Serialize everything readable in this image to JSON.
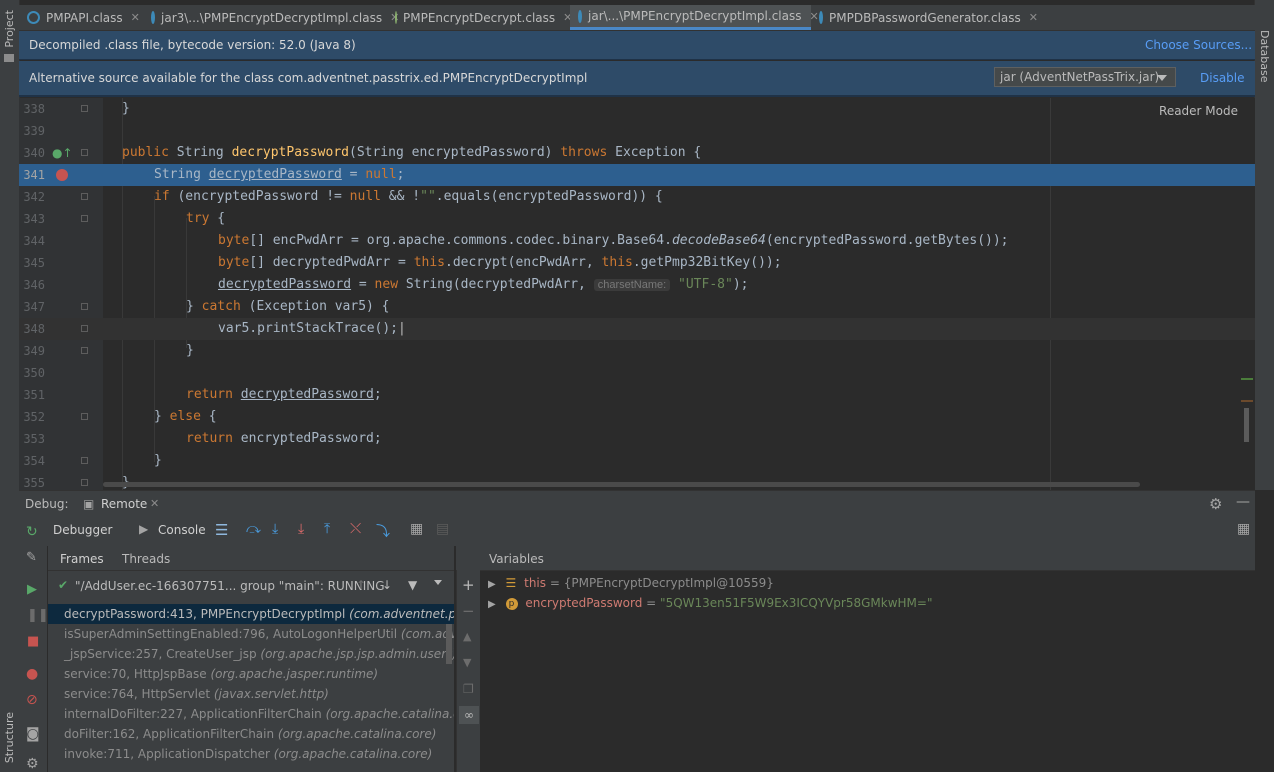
{
  "side_tabs": {
    "project": "Project",
    "structure": "Structure",
    "database": "Database"
  },
  "tabs": [
    {
      "label": "PMPAPI.class",
      "active": false
    },
    {
      "label": "jar3\\...\\PMPEncryptDecryptImpl.class",
      "active": false
    },
    {
      "label": "PMPEncryptDecrypt.class",
      "active": false
    },
    {
      "label": "jar\\...\\PMPEncryptDecryptImpl.class",
      "active": true
    },
    {
      "label": "PMPDBPasswordGenerator.class",
      "active": false
    }
  ],
  "banner1": {
    "text": "Decompiled .class file, bytecode version: 52.0 (Java 8)",
    "link": "Choose Sources..."
  },
  "banner2": {
    "text": "Alternative source available for the class com.adventnet.passtrix.ed.PMPEncryptDecryptImpl",
    "combo": "jar (AdventNetPassTrix.jar)",
    "link": "Disable"
  },
  "editor": {
    "reader_mode": "Reader Mode",
    "line_numbers": [
      "338",
      "339",
      "340",
      "341",
      "342",
      "343",
      "344",
      "345",
      "346",
      "347",
      "348",
      "349",
      "350",
      "351",
      "352",
      "353",
      "354",
      "355"
    ]
  },
  "code": {
    "l338": "}",
    "l340_kw1": "public",
    "l340_t1": " String ",
    "l340_fn": "decryptPassword",
    "l340_t2": "(String encryptedPassword) ",
    "l340_kw2": "throws",
    "l340_t3": " Exception {",
    "l341_t1": "String ",
    "l341_var": "decryptedPassword",
    "l341_t2": " = ",
    "l341_kw": "null",
    "l341_t3": ";",
    "l342_kw": "if",
    "l342_t1": " (encryptedPassword != ",
    "l342_kw2": "null",
    "l342_t2": " && !",
    "l342_str": "\"\"",
    "l342_t3": ".equals(encryptedPassword)) {",
    "l343_kw": "try",
    "l343_t": " {",
    "l344_kw": "byte",
    "l344_t1": "[] encPwdArr = org.apache.commons.codec.binary.Base64.",
    "l344_it": "decodeBase64",
    "l344_t2": "(encryptedPassword.getBytes());",
    "l345_kw": "byte",
    "l345_t1": "[] decryptedPwdArr = ",
    "l345_kw2": "this",
    "l345_t2": ".decrypt(encPwdArr, ",
    "l345_kw3": "this",
    "l345_t3": ".getPmp32BitKey());",
    "l346_var": "decryptedPassword",
    "l346_t1": " = ",
    "l346_kw": "new",
    "l346_t2": " String(decryptedPwdArr, ",
    "l346_hint": "charsetName:",
    "l346_str": "\"UTF-8\"",
    "l346_t3": ");",
    "l347_t1": "} ",
    "l347_kw": "catch",
    "l347_t2": " (Exception var5) {",
    "l348": "var5.printStackTrace();",
    "l349": "}",
    "l351_kw": "return",
    "l351_sp": " ",
    "l351_var": "decryptedPassword",
    "l351_t": ";",
    "l352_t1": "} ",
    "l352_kw": "else",
    "l352_t2": " {",
    "l353_kw": "return",
    "l353_t": " encryptedPassword;",
    "l354": "}",
    "l355": "}"
  },
  "debug": {
    "label": "Debug:",
    "session": "Remote",
    "tab_debugger": "Debugger",
    "tab_console": "Console",
    "tab_frames": "Frames",
    "tab_threads": "Threads",
    "variables_header": "Variables",
    "thread": "\"/AddUser.ec-166307751... group \"main\": RUNNING",
    "frames": [
      {
        "method": "decryptPassword:413, PMPEncryptDecryptImpl",
        "pkg": "(com.adventnet.passtrix.ed"
      },
      {
        "method": "isSuperAdminSettingEnabled:796, AutoLogonHelperUtil",
        "pkg": "(com.adventnet.pa"
      },
      {
        "method": "_jspService:257, CreateUser_jsp",
        "pkg": "(org.apache.jsp.jsp.admin.users)"
      },
      {
        "method": "service:70, HttpJspBase",
        "pkg": "(org.apache.jasper.runtime)"
      },
      {
        "method": "service:764, HttpServlet",
        "pkg": "(javax.servlet.http)"
      },
      {
        "method": "internalDoFilter:227, ApplicationFilterChain",
        "pkg": "(org.apache.catalina.core)"
      },
      {
        "method": "doFilter:162, ApplicationFilterChain",
        "pkg": "(org.apache.catalina.core)"
      },
      {
        "method": "invoke:711, ApplicationDispatcher",
        "pkg": "(org.apache.catalina.core)"
      }
    ],
    "variables": [
      {
        "name": "this",
        "eq": " = ",
        "value": "{PMPEncryptDecryptImpl@10559}"
      },
      {
        "name": "encryptedPassword",
        "eq": " = ",
        "value": "\"5QW13en51F5W9Ex3ICQYVpr58GMkwHM=\""
      }
    ]
  },
  "colors": {
    "keyword": "#cc7832",
    "function": "#ffc66d",
    "string": "#6a8759",
    "current_line": "#2d5f8f",
    "banner": "#2e4b68"
  }
}
